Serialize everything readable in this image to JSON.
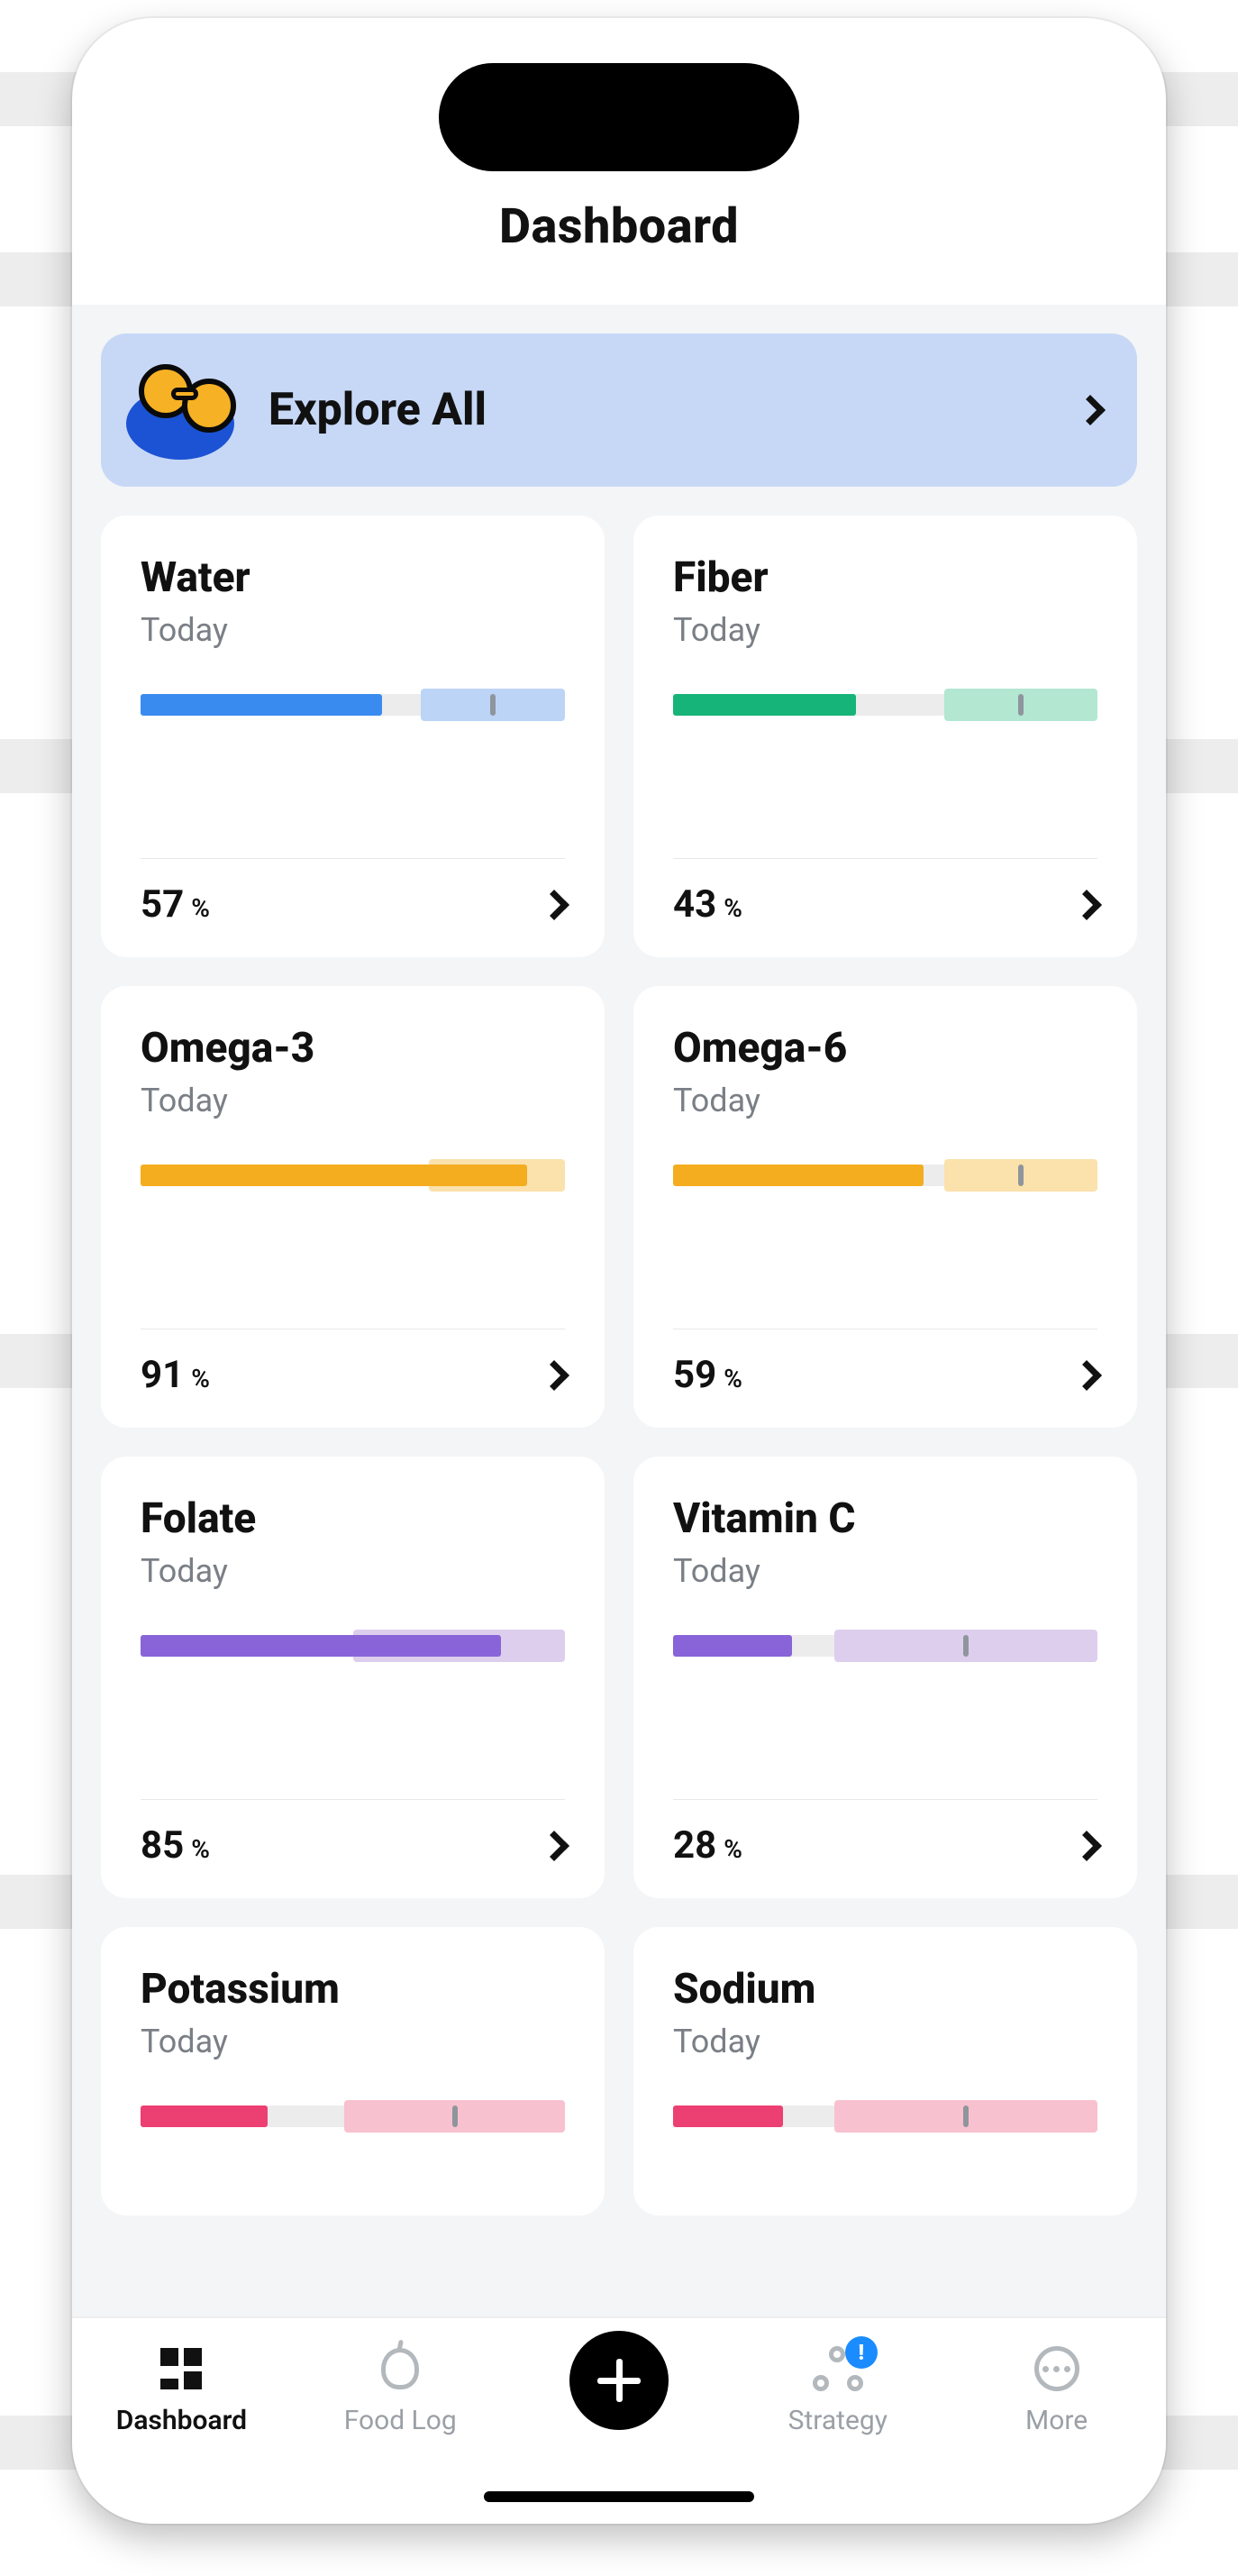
{
  "header": {
    "title": "Dashboard"
  },
  "explore": {
    "label": "Explore All"
  },
  "colors": {
    "blue": {
      "fill": "#3a8bf0",
      "target": "#bcd4f6"
    },
    "green": {
      "fill": "#17b479",
      "target": "#b3e7d2"
    },
    "amber": {
      "fill": "#f4ad1f",
      "target": "#fbe1ab"
    },
    "purple": {
      "fill": "#8864d8",
      "target": "#ddceee"
    },
    "pink": {
      "fill": "#ec3f72",
      "target": "#f8c1cf"
    }
  },
  "nutrients": [
    {
      "name": "Water",
      "period": "Today",
      "percent": 57,
      "color": "blue",
      "target_start": 66
    },
    {
      "name": "Fiber",
      "period": "Today",
      "percent": 43,
      "color": "green",
      "target_start": 64
    },
    {
      "name": "Omega-3",
      "period": "Today",
      "percent": 91,
      "color": "amber",
      "target_start": 68
    },
    {
      "name": "Omega-6",
      "period": "Today",
      "percent": 59,
      "color": "amber",
      "target_start": 64
    },
    {
      "name": "Folate",
      "period": "Today",
      "percent": 85,
      "color": "purple",
      "target_start": 50
    },
    {
      "name": "Vitamin C",
      "period": "Today",
      "percent": 28,
      "color": "purple",
      "target_start": 38
    },
    {
      "name": "Potassium",
      "period": "Today",
      "percent": null,
      "color": "pink",
      "target_start": 48,
      "fill_shown": 30
    },
    {
      "name": "Sodium",
      "period": "Today",
      "percent": null,
      "color": "pink",
      "target_start": 38,
      "fill_shown": 26
    }
  ],
  "percent_unit": "%",
  "tabs": [
    {
      "id": "dashboard",
      "label": "Dashboard",
      "active": true,
      "badge": false
    },
    {
      "id": "foodlog",
      "label": "Food Log",
      "active": false,
      "badge": false
    },
    {
      "id": "strategy",
      "label": "Strategy",
      "active": false,
      "badge": true,
      "badge_text": "!"
    },
    {
      "id": "more",
      "label": "More",
      "active": false,
      "badge": false
    }
  ]
}
